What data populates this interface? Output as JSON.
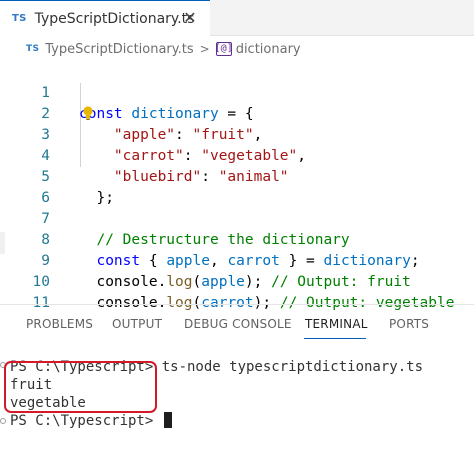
{
  "tab": {
    "badge": "TS",
    "title": "TypeScriptDictionary.ts",
    "close": "✕"
  },
  "breadcrumb": {
    "badge": "TS",
    "file": "TypeScriptDictionary.ts",
    "separator": ">",
    "symbol": "dictionary"
  },
  "editor": {
    "line_numbers": [
      "1",
      "2",
      "3",
      "4",
      "5",
      "6",
      "7",
      "8",
      "9",
      "10",
      "11"
    ],
    "code": {
      "l1": {
        "kw": "const",
        "var": "dictionary",
        "rest": " = {"
      },
      "l2": {
        "key": "\"apple\"",
        "sep": ": ",
        "val": "\"fruit\"",
        "end": ","
      },
      "l3": {
        "key": "\"carrot\"",
        "sep": ": ",
        "val": "\"vegetable\"",
        "end": ","
      },
      "l4": {
        "key": "\"bluebird\"",
        "sep": ": ",
        "val": "\"animal\""
      },
      "l5": {
        "text": "};"
      },
      "l7": {
        "comment": "// Destructure the dictionary"
      },
      "l8": {
        "kw": "const",
        "open": " { ",
        "a": "apple",
        "comma": ", ",
        "b": "carrot",
        "close": " } = ",
        "src": "dictionary",
        "end": ";"
      },
      "l9": {
        "obj": "console",
        "dot": ".",
        "fn": "log",
        "open": "(",
        "arg": "apple",
        "close": "); ",
        "comment": "// Output: fruit"
      },
      "l10": {
        "obj": "console",
        "dot": ".",
        "fn": "log",
        "open": "(",
        "arg": "carrot",
        "close": "); ",
        "comment": "// Output: vegetable"
      }
    }
  },
  "panel": {
    "tabs": [
      "PROBLEMS",
      "OUTPUT",
      "DEBUG CONSOLE",
      "TERMINAL",
      "PORTS"
    ],
    "active_tab": "TERMINAL"
  },
  "terminal": {
    "prompt1": "PS C:\\Typescript> ts-node typescriptdictionary.ts",
    "out1": "fruit",
    "out2": "vegetable",
    "prompt2": "PS C:\\Typescript> "
  },
  "colors": {
    "accent": "#005fb8",
    "highlight_box": "#d11a2a",
    "ts_badge": "#3178c6"
  }
}
